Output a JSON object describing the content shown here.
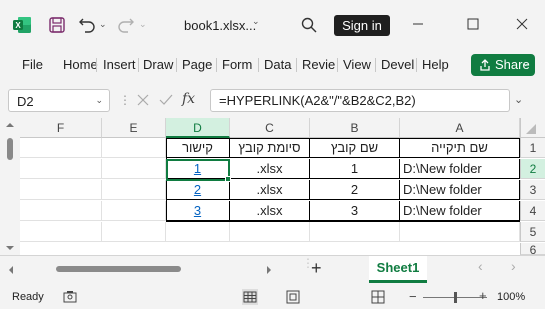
{
  "titlebar": {
    "doc_title": "book1.xlsx...",
    "signin_label": "Sign in",
    "icons": [
      "excel-logo-icon",
      "save-icon",
      "undo-icon",
      "redo-icon",
      "search-icon",
      "minimize-icon",
      "maximize-icon",
      "close-icon"
    ]
  },
  "menu": {
    "items": [
      "File",
      "Home",
      "Insert",
      "Draw",
      "Page",
      "Form",
      "Data",
      "Revie",
      "View",
      "Devel",
      "Help"
    ],
    "share_label": "Share"
  },
  "formula_bar": {
    "name_box": "D2",
    "formula": "=HYPERLINK(A2&\"/\"&B2&C2,B2)"
  },
  "grid": {
    "columns": [
      "F",
      "E",
      "D",
      "C",
      "B",
      "A"
    ],
    "selected_column": "D",
    "rows": [
      "1",
      "2",
      "3",
      "4",
      "5",
      "6"
    ],
    "selected_row": "2",
    "headers": {
      "A": "שם תיקייה",
      "B": "שם קובץ",
      "C": "סיומת קובץ",
      "D": "קישור"
    },
    "data": [
      {
        "A": "D:\\New folder",
        "B": "1",
        "C": ".xlsx",
        "D": "1"
      },
      {
        "A": "D:\\New folder",
        "B": "2",
        "C": ".xlsx",
        "D": "2"
      },
      {
        "A": "D:\\New folder",
        "B": "3",
        "C": ".xlsx",
        "D": "3"
      }
    ]
  },
  "sheets": {
    "active": "Sheet1",
    "add_label": "+"
  },
  "status": {
    "ready": "Ready",
    "zoom": "100%",
    "zoom_fraction": 0.5
  },
  "colors": {
    "accent": "#107c41",
    "link": "#0563c1"
  }
}
